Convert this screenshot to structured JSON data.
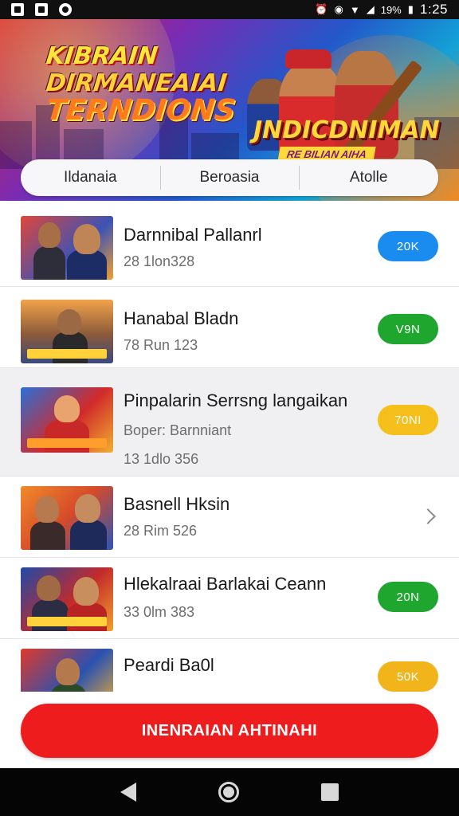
{
  "status_bar": {
    "time": "1:25",
    "battery": "19%",
    "icons": [
      "photo-icon",
      "gallery-icon",
      "message-icon",
      "alarm-icon",
      "vibrate-icon",
      "wifi-icon",
      "signal-icon",
      "battery-icon"
    ]
  },
  "banner": {
    "title_lines": [
      "KIBRAIN",
      "DIRMANEAIAI",
      "TERNDIONS"
    ],
    "subtitle": "JNDICDNIMAN",
    "tag": "RE BILIAN AIHA"
  },
  "tabs": [
    {
      "label": "Ildanaia"
    },
    {
      "label": "Beroasia"
    },
    {
      "label": "Atolle"
    }
  ],
  "list": {
    "items": [
      {
        "title": "Darnnibal Pallanrl",
        "subtitle": "",
        "meta": "28 1lon328",
        "badge": "20K",
        "badge_color": "#1a8cf0",
        "action": "badge"
      },
      {
        "title": "Hanabal Bladn",
        "subtitle": "",
        "meta": "78 Run 123",
        "badge": "V9N",
        "badge_color": "#1fa62e",
        "action": "badge"
      },
      {
        "title": "Pinpalarin Serrsng langaikan",
        "subtitle": "Boper: Barnniant",
        "meta": "13 1dlo 356",
        "badge": "70NI",
        "badge_color": "#f5c01c",
        "action": "badge"
      },
      {
        "title": "Basnell Hksin",
        "subtitle": "",
        "meta": "28 Rim 526",
        "badge": "",
        "badge_color": "",
        "action": "chevron"
      },
      {
        "title": "Hlekalraai Barlakai Ceann",
        "subtitle": "",
        "meta": "33 0lm 383",
        "badge": "20N",
        "badge_color": "#1fa62e",
        "action": "badge"
      },
      {
        "title": "Peardi Ba0l",
        "subtitle": "",
        "meta": "",
        "badge": "50K",
        "badge_color": "#f1b41a",
        "action": "badge"
      }
    ]
  },
  "cta": {
    "label": "INENRAIAN AHTINAHI"
  },
  "nav": {
    "icons": [
      "back-icon",
      "home-icon",
      "recents-icon"
    ]
  },
  "colors": {
    "accent_red": "#ee1c1c",
    "blue": "#1a8cf0",
    "green": "#1fa62e",
    "yellow": "#f5c01c"
  }
}
